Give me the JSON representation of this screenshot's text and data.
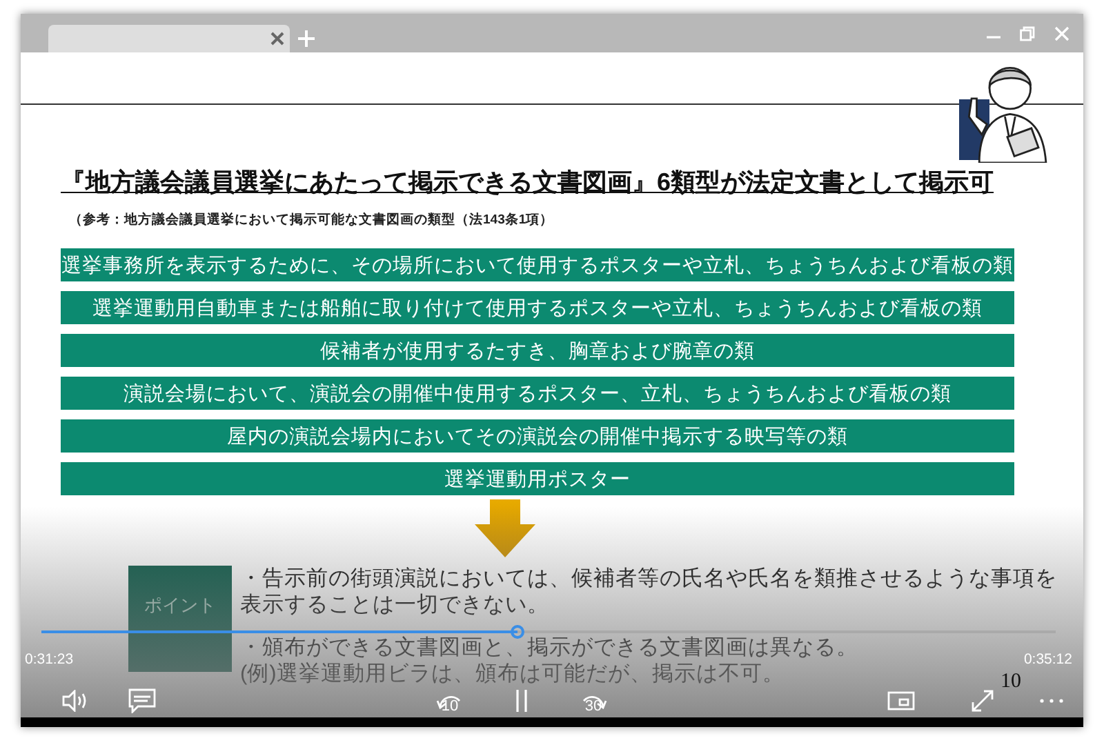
{
  "slide": {
    "title": "『地方議会議員選挙にあたって掲示できる文書図画』6類型が法定文書として掲示可",
    "reference": "（参考：地方議会議員選挙において掲示可能な文書図画の類型（法143条1項）",
    "items": [
      "選挙事務所を表示するために、その場所において使用するポスターや立札、ちょうちんおよび看板の類",
      "選挙運動用自動車または船舶に取り付けて使用するポスターや立札、ちょうちんおよび看板の類",
      "候補者が使用するたすき、胸章および腕章の類",
      "演説会場において、演説会の開催中使用するポスター、立札、ちょうちんおよび看板の類",
      "屋内の演説会場内においてその演説会の開催中掲示する映写等の類",
      "選挙運動用ポスター"
    ],
    "point": {
      "label": "ポイント",
      "lines": [
        "・告示前の街頭演説においては、候補者等の氏名や氏名を類推させるような事項を表示することは一切できない。",
        "・頒布ができる文書図画と、掲示ができる文書図画は異なる。",
        "(例)選挙運動用ビラは、頒布は可能だが、掲示は不可。"
      ]
    },
    "page_number": "10"
  },
  "player": {
    "elapsed": "0:31:23",
    "duration": "0:35:12",
    "level": 0.47,
    "rewind_label": "10",
    "forward_label": "30"
  }
}
